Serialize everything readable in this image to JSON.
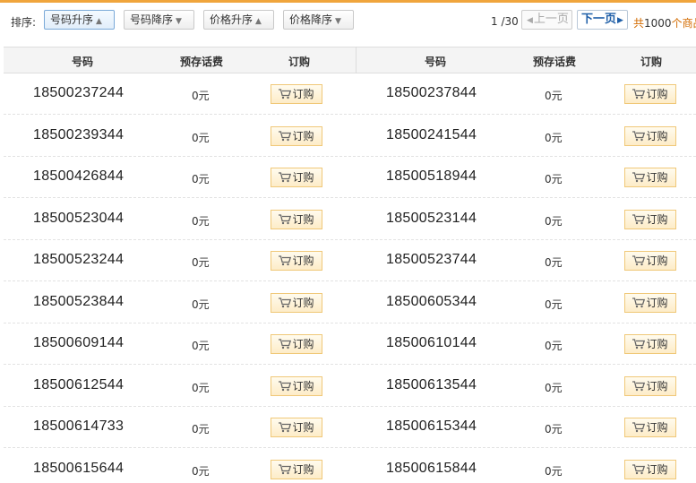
{
  "toolbar": {
    "sort_label": "排序:",
    "sort_buttons": [
      {
        "label": "号码升序",
        "active": true
      },
      {
        "label": "号码降序",
        "active": false
      },
      {
        "label": "价格升序",
        "active": false
      },
      {
        "label": "价格降序",
        "active": false
      }
    ],
    "page_info": "1 /30",
    "prev_label": "上一页",
    "next_label": "下一页",
    "total_prefix": "共",
    "total_count": "1000",
    "total_suffix": "个商品"
  },
  "table": {
    "headers": [
      "号码",
      "预存话费",
      "订购",
      "号码",
      "预存话费",
      "订购"
    ],
    "buy_label": "订购",
    "rows": [
      {
        "left": {
          "number": "18500237244",
          "fee": "0元"
        },
        "right": {
          "number": "18500237844",
          "fee": "0元"
        }
      },
      {
        "left": {
          "number": "18500239344",
          "fee": "0元"
        },
        "right": {
          "number": "18500241544",
          "fee": "0元"
        }
      },
      {
        "left": {
          "number": "18500426844",
          "fee": "0元"
        },
        "right": {
          "number": "18500518944",
          "fee": "0元"
        }
      },
      {
        "left": {
          "number": "18500523044",
          "fee": "0元"
        },
        "right": {
          "number": "18500523144",
          "fee": "0元"
        }
      },
      {
        "left": {
          "number": "18500523244",
          "fee": "0元"
        },
        "right": {
          "number": "18500523744",
          "fee": "0元"
        }
      },
      {
        "left": {
          "number": "18500523844",
          "fee": "0元"
        },
        "right": {
          "number": "18500605344",
          "fee": "0元"
        }
      },
      {
        "left": {
          "number": "18500609144",
          "fee": "0元"
        },
        "right": {
          "number": "18500610144",
          "fee": "0元"
        }
      },
      {
        "left": {
          "number": "18500612544",
          "fee": "0元"
        },
        "right": {
          "number": "18500613544",
          "fee": "0元"
        }
      },
      {
        "left": {
          "number": "18500614733",
          "fee": "0元"
        },
        "right": {
          "number": "18500615344",
          "fee": "0元"
        }
      },
      {
        "left": {
          "number": "18500615644",
          "fee": "0元"
        },
        "right": {
          "number": "18500615844",
          "fee": "0元"
        }
      }
    ]
  },
  "colors": {
    "accent": "#f0a53c",
    "link": "#1f5fa8",
    "total": "#d36b00"
  }
}
